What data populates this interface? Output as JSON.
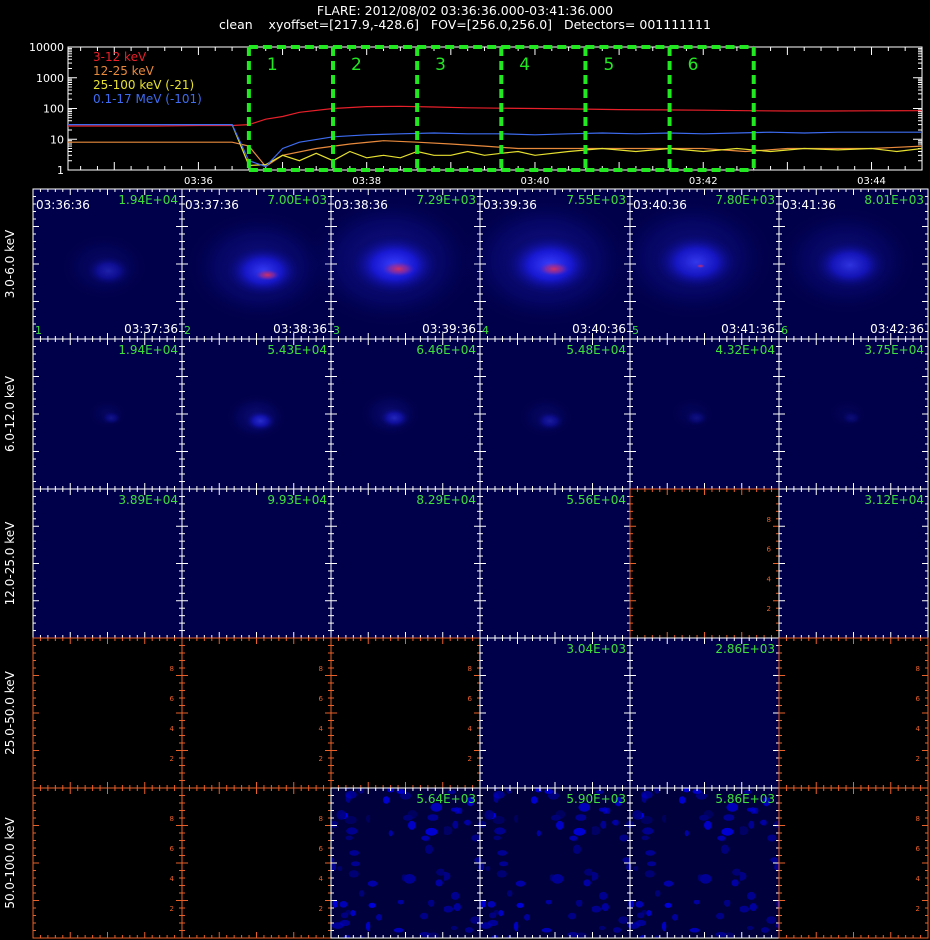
{
  "header": {
    "title": "FLARE: 2012/08/02 03:36:36.000-03:41:36.000",
    "subtitle": "clean    xyoffset=[217.9,-428.6]   FOV=[256.0,256.0]   Detectors= 001111111"
  },
  "chart_data": [
    {
      "type": "line",
      "yscale": "log",
      "ylim": [
        1,
        10000
      ],
      "y_ticks": [
        "1",
        "10",
        "100",
        "1000",
        "10000"
      ],
      "x_ticks": [
        "03:36",
        "03:38",
        "03:40",
        "03:42",
        "03:44"
      ],
      "x_tick_minutes": [
        36,
        38,
        40,
        42,
        44
      ],
      "xlim_minutes": [
        34.45,
        44.6
      ],
      "legend_placement": "top-left",
      "colors": {
        "s1": "#e8202a",
        "s2": "#e88a3c",
        "s3": "#e6e030",
        "s4": "#3d6cf0",
        "box": "#22e822"
      },
      "series": [
        {
          "name": "3-12 keV",
          "color": "#e8202a",
          "x": [
            34.45,
            35.0,
            35.5,
            36.0,
            36.4,
            36.6,
            36.8,
            37.0,
            37.2,
            37.6,
            38.0,
            38.4,
            38.8,
            39.2,
            39.6,
            40.0,
            40.5,
            41.0,
            41.5,
            42.0,
            42.5,
            43.0,
            43.5,
            44.0,
            44.6
          ],
          "y": [
            27,
            27,
            27,
            28,
            28,
            30,
            45,
            55,
            75,
            100,
            115,
            118,
            112,
            105,
            102,
            100,
            96,
            92,
            90,
            88,
            85,
            83,
            83,
            84,
            85
          ]
        },
        {
          "name": "12-25 keV",
          "color": "#e88a3c",
          "x": [
            34.45,
            35.0,
            35.5,
            36.0,
            36.4,
            36.6,
            36.8,
            37.0,
            37.4,
            37.8,
            38.2,
            38.6,
            39.0,
            39.4,
            39.8,
            40.2,
            40.6,
            41.0,
            41.5,
            42.0,
            42.5,
            43.0,
            43.5,
            44.0,
            44.6
          ],
          "y": [
            8,
            8,
            8,
            8,
            8,
            6,
            1.3,
            3,
            5,
            7,
            9,
            8,
            7,
            6,
            5,
            5,
            5,
            5,
            5,
            5,
            4,
            5,
            5,
            5,
            6
          ]
        },
        {
          "name": "25-100 keV (-21)",
          "color": "#e6e030",
          "x": [
            36.4,
            36.6,
            36.8,
            37.0,
            37.2,
            37.4,
            37.6,
            37.8,
            38.0,
            38.2,
            38.4,
            38.6,
            38.8,
            39.0,
            39.2,
            39.4,
            39.6,
            39.8,
            40.0,
            40.4,
            40.8,
            41.2,
            41.6,
            42.0,
            42.4,
            42.8,
            43.2,
            43.6,
            44.0,
            44.3,
            44.6
          ],
          "y": [
            30,
            1.4,
            1.5,
            3,
            2,
            3.5,
            2,
            4,
            2.5,
            3,
            2.5,
            4,
            3,
            3,
            4,
            3,
            3.5,
            4,
            3,
            4,
            5,
            4,
            5,
            4,
            5,
            4,
            5,
            4.5,
            5,
            4,
            5
          ]
        },
        {
          "name": "0.1-17 MeV (-101)",
          "color": "#3d6cf0",
          "x": [
            34.45,
            35.0,
            35.5,
            36.0,
            36.4,
            36.6,
            36.8,
            37.0,
            37.2,
            37.6,
            38.0,
            38.4,
            38.8,
            39.2,
            39.6,
            40.0,
            40.4,
            40.8,
            41.2,
            41.6,
            42.0,
            42.4,
            42.8,
            43.2,
            43.6,
            44.0,
            44.6
          ],
          "y": [
            30,
            30,
            30,
            30,
            30,
            2,
            1.3,
            5,
            8,
            12,
            14,
            15,
            16,
            15,
            15,
            14,
            15,
            16,
            15,
            16,
            15,
            16,
            17,
            16,
            17,
            17,
            17
          ]
        }
      ],
      "intervals": [
        {
          "label": "1",
          "start_min": 36.6,
          "end_min": 37.6
        },
        {
          "label": "2",
          "start_min": 37.6,
          "end_min": 38.6
        },
        {
          "label": "3",
          "start_min": 38.6,
          "end_min": 39.6
        },
        {
          "label": "4",
          "start_min": 39.6,
          "end_min": 40.6
        },
        {
          "label": "5",
          "start_min": 40.6,
          "end_min": 41.6
        },
        {
          "label": "6",
          "start_min": 41.6,
          "end_min": 42.6
        }
      ]
    },
    {
      "type": "heatmap",
      "row_labels": [
        "3.0-6.0 keV",
        "6.0-12.0 keV",
        "12.0-25.0 keV",
        "25.0-50.0 keV",
        "50.0-100.0 keV"
      ],
      "col_start_times": [
        "03:36:36",
        "03:37:36",
        "03:38:36",
        "03:39:36",
        "03:40:36",
        "03:41:36"
      ],
      "col_end_times": [
        "03:37:36",
        "03:38:36",
        "03:39:36",
        "03:40:36",
        "03:41:36",
        "03:42:36"
      ],
      "col_numbers": [
        "1",
        "2",
        "3",
        "4",
        "5",
        "6"
      ],
      "axis_tick_labels": [
        "2",
        "4",
        "6",
        "8"
      ],
      "rows": [
        {
          "cells": [
            {
              "max": "1.94E+04",
              "mode": "blob",
              "strength": 0.45,
              "spread": 0.8,
              "red": 0.0,
              "cx": 0.48,
              "cy": 0.52
            },
            {
              "max": "7.00E+03",
              "mode": "blob",
              "strength": 0.9,
              "spread": 1.35,
              "red": 0.55,
              "cx": 0.52,
              "cy": 0.52
            },
            {
              "max": "7.29E+03",
              "mode": "blob",
              "strength": 1.0,
              "spread": 1.6,
              "red": 0.75,
              "cx": 0.4,
              "cy": 0.48
            },
            {
              "max": "7.55E+03",
              "mode": "blob",
              "strength": 1.0,
              "spread": 1.6,
              "red": 0.7,
              "cx": 0.44,
              "cy": 0.48
            },
            {
              "max": "7.80E+03",
              "mode": "blob",
              "strength": 0.85,
              "spread": 1.5,
              "red": 0.2,
              "cx": 0.42,
              "cy": 0.46
            },
            {
              "max": "8.01E+03",
              "mode": "blob",
              "strength": 0.75,
              "spread": 1.3,
              "red": 0.0,
              "cx": 0.45,
              "cy": 0.48
            }
          ]
        },
        {
          "cells": [
            {
              "max": "1.94E+04",
              "mode": "blob",
              "strength": 0.3,
              "spread": 0.35,
              "red": 0.0,
              "cx": 0.5,
              "cy": 0.5
            },
            {
              "max": "5.43E+04",
              "mode": "blob",
              "strength": 0.65,
              "spread": 0.55,
              "red": 0.0,
              "cx": 0.5,
              "cy": 0.52
            },
            {
              "max": "6.46E+04",
              "mode": "blob",
              "strength": 0.55,
              "spread": 0.55,
              "red": 0.0,
              "cx": 0.4,
              "cy": 0.5
            },
            {
              "max": "5.48E+04",
              "mode": "blob",
              "strength": 0.4,
              "spread": 0.5,
              "red": 0.0,
              "cx": 0.44,
              "cy": 0.52
            },
            {
              "max": "4.32E+04",
              "mode": "blob",
              "strength": 0.25,
              "spread": 0.4,
              "red": 0.0,
              "cx": 0.42,
              "cy": 0.5
            },
            {
              "max": "3.75E+04",
              "mode": "blob",
              "strength": 0.2,
              "spread": 0.35,
              "red": 0.0,
              "cx": 0.46,
              "cy": 0.5
            }
          ]
        },
        {
          "cells": [
            {
              "max": "3.89E+04",
              "mode": "flat"
            },
            {
              "max": "9.93E+04",
              "mode": "flat"
            },
            {
              "max": "8.29E+04",
              "mode": "flat"
            },
            {
              "max": "5.56E+04",
              "mode": "flat"
            },
            {
              "max": "",
              "mode": "empty"
            },
            {
              "max": "3.12E+04",
              "mode": "flat"
            }
          ]
        },
        {
          "cells": [
            {
              "max": "",
              "mode": "empty"
            },
            {
              "max": "",
              "mode": "empty"
            },
            {
              "max": "",
              "mode": "empty"
            },
            {
              "max": "3.04E+03",
              "mode": "flat"
            },
            {
              "max": "2.86E+03",
              "mode": "flat"
            },
            {
              "max": "",
              "mode": "empty"
            }
          ]
        },
        {
          "cells": [
            {
              "max": "",
              "mode": "empty"
            },
            {
              "max": "",
              "mode": "empty"
            },
            {
              "max": "5.64E+03",
              "mode": "noise"
            },
            {
              "max": "5.90E+03",
              "mode": "noise"
            },
            {
              "max": "5.86E+03",
              "mode": "noise"
            },
            {
              "max": "",
              "mode": "empty"
            }
          ]
        }
      ]
    }
  ]
}
